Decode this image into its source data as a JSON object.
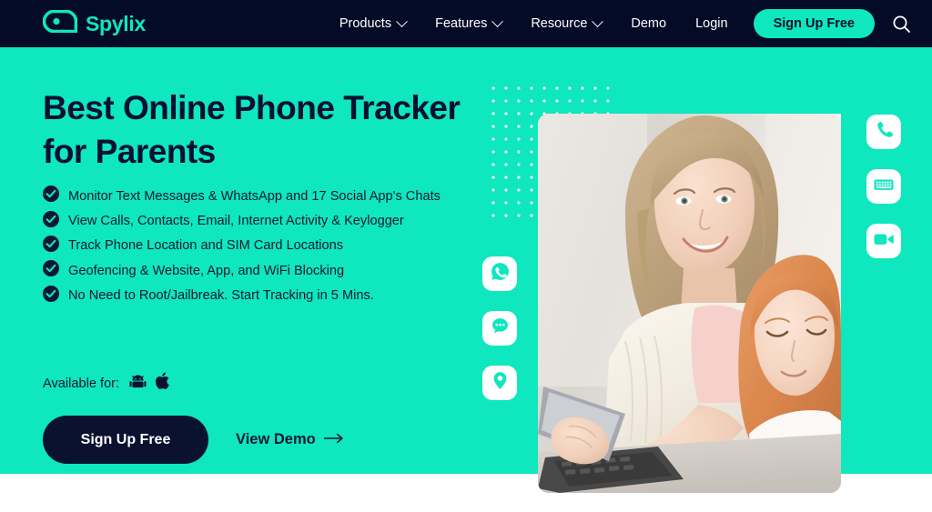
{
  "brand": {
    "name": "Spylix",
    "logo_icon": "spylix-eye-logo",
    "accent_color": "#0FE7BE",
    "dark_color": "#040B26"
  },
  "header": {
    "nav_items": [
      {
        "label": "Products",
        "has_dropdown": true,
        "icon": "chevron-down-icon"
      },
      {
        "label": "Features",
        "has_dropdown": true,
        "icon": "chevron-down-icon"
      },
      {
        "label": "Resource",
        "has_dropdown": true,
        "icon": "chevron-down-icon"
      },
      {
        "label": "Demo",
        "has_dropdown": false,
        "icon": ""
      },
      {
        "label": "Login",
        "has_dropdown": false,
        "icon": ""
      }
    ],
    "signup_label": "Sign Up Free",
    "search_icon": "search-icon"
  },
  "hero": {
    "headline": "Best Online Phone Tracker for Parents",
    "bullets": [
      "Monitor Text Messages & WhatsApp and 17 Social App's Chats",
      "View Calls, Contacts, Email, Internet Activity & Keylogger",
      "Track Phone Location and SIM Card Locations",
      "Geofencing & Website, App, and WiFi Blocking",
      "No Need to Root/Jailbreak. Start Tracking in 5 Mins."
    ],
    "bullet_icon": "check-circle-icon",
    "available_label": "Available for:",
    "platforms": [
      {
        "name": "Android",
        "icon": "android-icon"
      },
      {
        "name": "iOS",
        "icon": "apple-icon"
      }
    ],
    "cta_primary": "Sign Up Free",
    "cta_secondary": "View Demo",
    "cta_secondary_icon": "arrow-right-icon",
    "background_color": "#0FE7BE",
    "text_color": "#0B1736"
  },
  "floating_icons": {
    "left": [
      {
        "name": "whatsapp-icon",
        "title": "WhatsApp"
      },
      {
        "name": "chat-bubble-icon",
        "title": "Messages"
      },
      {
        "name": "location-pin-icon",
        "title": "Location"
      }
    ],
    "right": [
      {
        "name": "phone-call-icon",
        "title": "Calls"
      },
      {
        "name": "keyboard-icon",
        "title": "Keylogger"
      },
      {
        "name": "video-camera-icon",
        "title": "Video"
      }
    ]
  },
  "photo": {
    "alt": "Mother and daughter looking at a smartphone together",
    "name": "hero-photo"
  }
}
